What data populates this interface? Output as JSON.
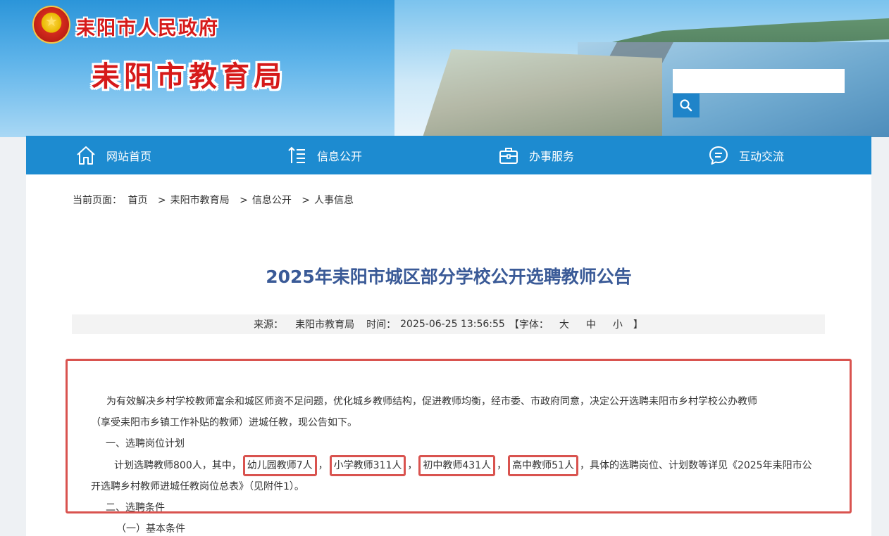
{
  "header": {
    "gov_name": "耒阳市人民政府",
    "bureau_name": "耒阳市教育局",
    "search": {
      "placeholder": ""
    }
  },
  "nav": {
    "items": [
      {
        "label": "网站首页",
        "icon": "home-icon"
      },
      {
        "label": "信息公开",
        "icon": "list-icon"
      },
      {
        "label": "办事服务",
        "icon": "briefcase-icon"
      },
      {
        "label": "互动交流",
        "icon": "chat-icon"
      }
    ]
  },
  "breadcrumb": {
    "prefix": "当前页面：",
    "items": [
      "首页",
      "耒阳市教育局",
      "信息公开",
      "人事信息"
    ],
    "separator": ">"
  },
  "article": {
    "title": "2025年耒阳市城区部分学校公开选聘教师公告",
    "meta": {
      "source_label": "来源：",
      "source": "耒阳市教育局",
      "time_label": "时间：",
      "time": "2025-06-25 13:56:55",
      "font_label": "【字体：",
      "font_large": "大",
      "font_medium": "中",
      "font_small": "小",
      "font_close": "】"
    },
    "intro_line1": "为有效解决乡村学校教师富余和城区师资不足问题，优化城乡教师结构，促进教师均衡，经市委、市政府同意，决定公开选聘耒阳市乡村学校公办教师",
    "intro_line2": "（享受耒阳市乡镇工作补贴的教师）进城任教，现公告如下。",
    "section1": "一、选聘岗位计划",
    "plan_prefix": "计划选聘教师800人，其中，",
    "plan_kindergarten": "幼儿园教师7人",
    "plan_primary": "小学教师311人",
    "plan_junior": "初中教师431人",
    "plan_senior": "高中教师51人",
    "plan_comma": "，",
    "plan_suffix": "具体的选聘岗位、计划数等详见《2025年耒阳市公",
    "plan_line2": "开选聘乡村教师进城任教岗位总表》（见附件1）。",
    "section2": "二、选聘条件",
    "subsection1": "（一）基本条件"
  },
  "colors": {
    "nav_bg": "#1d8bd0",
    "title": "#3a5a97",
    "highlight_border": "#d9534f",
    "brand_red": "#d61a1a"
  }
}
